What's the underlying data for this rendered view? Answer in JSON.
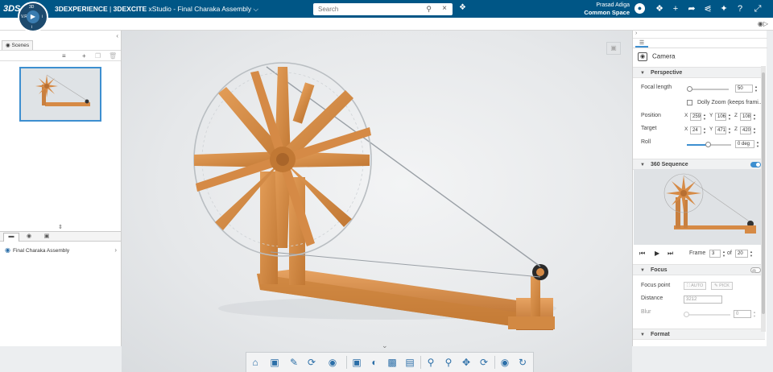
{
  "topbar": {
    "logo": "3DS",
    "compass": {
      "center": "▶",
      "n": "3D",
      "w": "V.R",
      "e": "i",
      "s": "i"
    },
    "brand": "3DEXPERIENCE",
    "separator": " | ",
    "app": "3DEXCITE",
    "document": " xStudio - Final Charaka Assembly",
    "search": {
      "placeholder": "Search",
      "value": ""
    },
    "user_name": "Prasad Adiga",
    "space": "Common Space",
    "icons": [
      "user-icon",
      "tag-icon",
      "add-icon",
      "share-arrow-icon",
      "network-icon",
      "compass-tools-icon",
      "help-icon",
      "expand-icon"
    ]
  },
  "left_panel": {
    "scenes_tab": "Scenes",
    "bottom_tabs": [
      "tree",
      "materials",
      "images"
    ],
    "tree_item": "Final Charaka Assembly"
  },
  "right_panel": {
    "camera_title": "Camera",
    "perspective": {
      "header": "Perspective",
      "focal_length_label": "Focal length",
      "focal_length_value": "50",
      "dolly_zoom_label": "Dolly Zoom (keeps frami...",
      "position_label": "Position",
      "position": {
        "x": "259",
        "y": "106",
        "z": "108"
      },
      "target_label": "Target",
      "target": {
        "x": "24",
        "y": "471",
        "z": "420"
      },
      "roll_label": "Roll",
      "roll_value": "0 deg"
    },
    "sequence": {
      "header": "360 Sequence",
      "enabled": true,
      "frame_label": "Frame",
      "frame_value": "3",
      "of_label": "of",
      "total_value": "20"
    },
    "focus": {
      "header": "Focus",
      "enabled": false,
      "focus_point_label": "Focus point",
      "auto_label": "AUTO",
      "pick_label": "PICK",
      "distance_label": "Distance",
      "distance_value": "3212",
      "blur_label": "Blur",
      "blur_value": "0"
    },
    "format": {
      "header": "Format"
    }
  },
  "colors": {
    "topbar": "#005686",
    "accent": "#3d8fd0",
    "wood": "#d68a45"
  }
}
